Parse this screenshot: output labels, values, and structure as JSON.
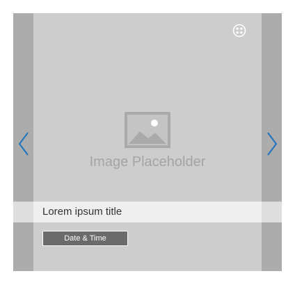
{
  "carousel": {
    "prev_icon": "chevron-left-icon",
    "next_icon": "chevron-right-icon",
    "corner_icon": "grid-dots-icon",
    "image_placeholder_icon": "image-icon",
    "image_placeholder_text": "Image Placeholder",
    "title": "Lorem ipsum title",
    "date_button_label": "Date & Time"
  },
  "colors": {
    "arrow": "#1e73be",
    "background": "#cdcdcd",
    "side_panel": "#acacac",
    "title_band": "#efefef",
    "button": "#6b6b6b"
  }
}
